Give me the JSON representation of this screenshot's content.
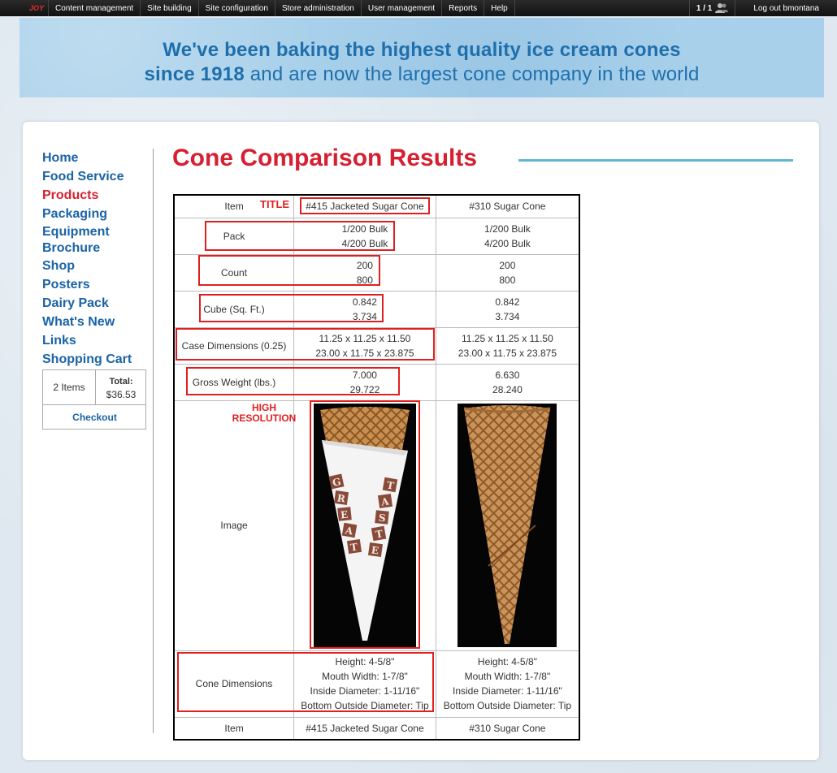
{
  "toolbar": {
    "logo": "JOY",
    "menu": [
      "Content management",
      "Site building",
      "Site configuration",
      "Store administration",
      "User management",
      "Reports",
      "Help"
    ],
    "users_count": "1 / 1",
    "logout": "Log out bmontana"
  },
  "banner": {
    "line1": "We've been baking the highest quality ice cream cones",
    "line2_bold": "since 1918",
    "line2_rest": " and are now the largest cone company in the world"
  },
  "nav": {
    "items": [
      "Home",
      "Food Service",
      "Products",
      "Packaging",
      "Equipment Brochure",
      "Shop",
      "Posters",
      "Dairy Pack",
      "What's New",
      "Links",
      "Shopping Cart"
    ],
    "active": "Products"
  },
  "cart": {
    "items": "2 Items",
    "total_label": "Total:",
    "total_value": "$36.53",
    "checkout": "Checkout"
  },
  "page": {
    "title": "Cone Comparison Results"
  },
  "table": {
    "header": {
      "label": "Item",
      "a": "#415 Jacketed Sugar Cone",
      "b": "#310 Sugar Cone"
    },
    "pack": {
      "label": "Pack",
      "a": [
        "1/200 Bulk",
        "4/200 Bulk"
      ],
      "b": [
        "1/200 Bulk",
        "4/200 Bulk"
      ]
    },
    "count": {
      "label": "Count",
      "a": [
        "200",
        "800"
      ],
      "b": [
        "200",
        "800"
      ]
    },
    "cube": {
      "label": "Cube (Sq. Ft.)",
      "a": [
        "0.842",
        "3.734"
      ],
      "b": [
        "0.842",
        "3.734"
      ]
    },
    "case": {
      "label": "Case Dimensions (0.25)",
      "a": [
        "11.25 x 11.25 x 11.50",
        "23.00 x 11.75 x 23.875"
      ],
      "b": [
        "11.25 x 11.25 x 11.50",
        "23.00 x 11.75 x 23.875"
      ]
    },
    "weight": {
      "label": "Gross Weight (lbs.)",
      "a": [
        "7.000",
        "29.722"
      ],
      "b": [
        "6.630",
        "28.240"
      ]
    },
    "image": {
      "label": "Image",
      "jacket_text": "GREAT TASTE"
    },
    "cone_dims": {
      "label": "Cone Dimensions",
      "a": [
        "Height: 4-5/8\"",
        "Mouth Width: 1-7/8\"",
        "Inside Diameter: 1-11/16\"",
        "Bottom Outside Diameter: Tip"
      ],
      "b": [
        "Height: 4-5/8\"",
        "Mouth Width: 1-7/8\"",
        "Inside Diameter: 1-11/16\"",
        "Bottom Outside Diameter: Tip"
      ]
    },
    "footer": {
      "label": "Item",
      "a": "#415 Jacketed Sugar Cone",
      "b": "#310 Sugar Cone"
    }
  },
  "annotations": {
    "title_label": "TITLE",
    "high_res_line1": "HIGH",
    "high_res_line2": "RESOLUTION"
  },
  "colors": {
    "nav_link": "#1a63a6",
    "nav_active": "#d62032",
    "heading": "#d62032",
    "banner_bg": "#a8d0ea",
    "banner_text": "#1f6fad",
    "annotation": "#e02020",
    "heading_rule": "#5fb7d0"
  }
}
